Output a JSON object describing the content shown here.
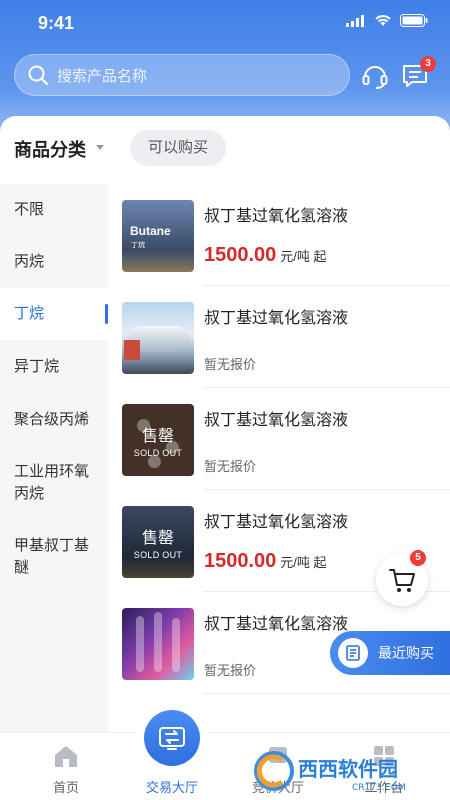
{
  "status": {
    "time": "9:41"
  },
  "search": {
    "placeholder": "搜索产品名称"
  },
  "header": {
    "message_badge": "3"
  },
  "filter": {
    "title": "商品分类",
    "chip": "可以购买"
  },
  "categories": [
    {
      "label": "不限",
      "active": false
    },
    {
      "label": "丙烷",
      "active": false
    },
    {
      "label": "丁烷",
      "active": true
    },
    {
      "label": "异丁烷",
      "active": false
    },
    {
      "label": "聚合级丙烯",
      "active": false
    },
    {
      "label": "工业用环氧丙烷",
      "active": false
    },
    {
      "label": "甲基叔丁基醚",
      "active": false
    }
  ],
  "products": [
    {
      "name": "叔丁基过氧化氢溶液",
      "price": "1500.00",
      "unit": "元/吨 起",
      "thumb_text": "Butane",
      "thumb_sub": "丁烷"
    },
    {
      "name": "叔丁基过氧化氢溶液",
      "no_quote": "暂无报价"
    },
    {
      "name": "叔丁基过氧化氢溶液",
      "no_quote": "暂无报价",
      "sold": "售罄",
      "sold_en": "SOLD OUT"
    },
    {
      "name": "叔丁基过氧化氢溶液",
      "price": "1500.00",
      "unit": "元/吨 起",
      "sold": "售罄",
      "sold_en": "SOLD OUT"
    },
    {
      "name": "叔丁基过氧化氢溶液",
      "no_quote": "暂无报价"
    }
  ],
  "cart": {
    "badge": "5"
  },
  "recent": {
    "label": "最近购买"
  },
  "tabs": [
    {
      "label": "首页"
    },
    {
      "label": "交易大厅"
    },
    {
      "label": "竞价大厅"
    },
    {
      "label": "工作台"
    }
  ],
  "watermark": {
    "brand": "西西软件园",
    "url": "CR173.COM"
  },
  "colors": {
    "accent": "#2f6fe0",
    "price": "#d42a2a",
    "badge": "#ee3b3b"
  }
}
